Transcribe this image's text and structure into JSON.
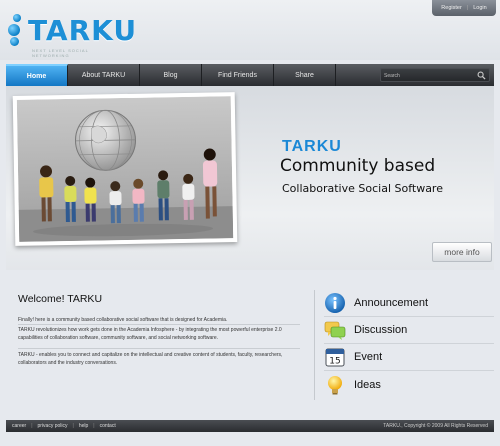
{
  "header": {
    "logo_text": "TARKU",
    "logo_tagline": "NEXT LEVEL SOCIAL NETWORKING",
    "account": {
      "register": "Register",
      "login": "Login",
      "separator": "|"
    }
  },
  "nav": {
    "items": [
      {
        "label": "Home",
        "active": true
      },
      {
        "label": "About TARKU",
        "active": false
      },
      {
        "label": "Blog",
        "active": false
      },
      {
        "label": "Find Friends",
        "active": false
      },
      {
        "label": "Share",
        "active": false
      }
    ],
    "search_placeholder": "Search",
    "search_icon": "magnifier-icon"
  },
  "hero": {
    "brand": "TARKU",
    "title": "Community based",
    "subtitle": "Collaborative Social Software",
    "more_info": "more info"
  },
  "welcome": {
    "title": "Welcome! TARKU",
    "paragraphs": [
      "Finally! here is a community based collaborative social software that is designed for Academia.",
      "TARKU revolutionizes how work gets done in the Academia Infosphere - by integrating the most powerful enterprise 2.0 capabilities of collaboration software, community software, and social networking software.",
      "TARKU - enables you to connect and capitalize on the intellectual and creative content of students, faculty, researchers, collaborators and the industry conversations."
    ]
  },
  "features": [
    {
      "label": "Announcement",
      "icon": "info-icon"
    },
    {
      "label": "Discussion",
      "icon": "chat-icon"
    },
    {
      "label": "Event",
      "icon": "calendar-icon"
    },
    {
      "label": "Ideas",
      "icon": "lightbulb-icon"
    }
  ],
  "calendar_day": "15",
  "footer": {
    "links": [
      "career",
      "privacy policy",
      "help",
      "contact"
    ],
    "separator": "|",
    "copyright": "TARKU., Copyright © 2009 All Rights Reserved"
  },
  "colors": {
    "accent": "#1b88d6",
    "nav_dark": "#2a2c30",
    "background": "#e6e9ee"
  }
}
